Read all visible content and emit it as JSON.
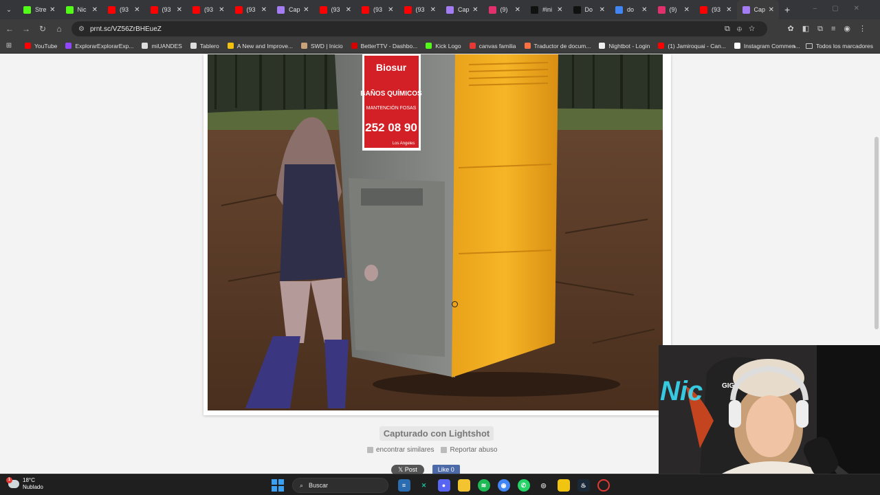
{
  "tabs": [
    {
      "title": "Stre",
      "icon": "kick-icon",
      "color": "#53fc18"
    },
    {
      "title": "Nic",
      "icon": "kick-icon",
      "color": "#53fc18"
    },
    {
      "title": "(93",
      "icon": "youtube-icon",
      "color": "#ff0000"
    },
    {
      "title": "(93",
      "icon": "youtube-icon",
      "color": "#ff0000"
    },
    {
      "title": "(93",
      "icon": "youtube-icon",
      "color": "#ff0000"
    },
    {
      "title": "(93",
      "icon": "youtube-icon",
      "color": "#ff0000"
    },
    {
      "title": "Cap",
      "icon": "lightshot-feather-icon",
      "color": "#a47cf3"
    },
    {
      "title": "(93",
      "icon": "youtube-icon",
      "color": "#ff0000"
    },
    {
      "title": "(93",
      "icon": "youtube-icon",
      "color": "#ff0000"
    },
    {
      "title": "(93",
      "icon": "youtube-icon",
      "color": "#ff0000"
    },
    {
      "title": "Cap",
      "icon": "lightshot-feather-icon",
      "color": "#a47cf3"
    },
    {
      "title": "(9)",
      "icon": "instagram-icon",
      "color": "#e1306c"
    },
    {
      "title": "#ini",
      "icon": "tiktok-icon",
      "color": "#111111"
    },
    {
      "title": "Do",
      "icon": "tiktok-icon",
      "color": "#111111"
    },
    {
      "title": "do",
      "icon": "google-icon",
      "color": "#4285f4"
    },
    {
      "title": "(9)",
      "icon": "instagram-icon",
      "color": "#e1306c"
    },
    {
      "title": "(93",
      "icon": "youtube-icon",
      "color": "#ff0000"
    },
    {
      "title": "Cap",
      "icon": "lightshot-feather-icon",
      "color": "#a47cf3",
      "active": true
    }
  ],
  "address": {
    "url": "prnt.sc/VZ56ZrBHEueZ"
  },
  "bookmarks": [
    {
      "label": "YouTube",
      "color": "#ff0000"
    },
    {
      "label": "ExplorarExplorarExp...",
      "color": "#9146ff"
    },
    {
      "label": "miUANDES",
      "color": "#dddddd"
    },
    {
      "label": "Tablero",
      "color": "#dddddd"
    },
    {
      "label": "A New and Improve...",
      "color": "#f4c20d"
    },
    {
      "label": "SWD | Inicio",
      "color": "#c8a27a"
    },
    {
      "label": "BetterTTV - Dashbo...",
      "color": "#d50000"
    },
    {
      "label": "Kick Logo",
      "color": "#53fc18"
    },
    {
      "label": "canvas familia",
      "color": "#e53935"
    },
    {
      "label": "Traductor de docum...",
      "color": "#ff7043"
    },
    {
      "label": "Nightbot - Login",
      "color": "#eeeeee"
    },
    {
      "label": "(1) Jamiroquai - Can...",
      "color": "#ff0000"
    },
    {
      "label": "Instagram Commen...",
      "color": "#ffffff"
    }
  ],
  "all_bookmarks_label": "Todos los marcadores",
  "photo_sign": {
    "brand": "Biosur",
    "line1": "BAÑOS QUÍMICOS",
    "line2": "MANTENCIÓN FOSAS",
    "phone": "252 08 90",
    "city": "Los Angeles"
  },
  "caption": "Capturado con Lightshot",
  "links": {
    "similar": "encontrar similares",
    "report": "Reportar abuso"
  },
  "share": {
    "post": "Post",
    "like": "Like 0"
  },
  "webcam": {
    "text": "GIGABYTE",
    "neon": "Nic"
  },
  "weather": {
    "temp": "18°C",
    "condition": "Nublado",
    "badge": "1"
  },
  "taskbar": {
    "search": "Buscar"
  }
}
